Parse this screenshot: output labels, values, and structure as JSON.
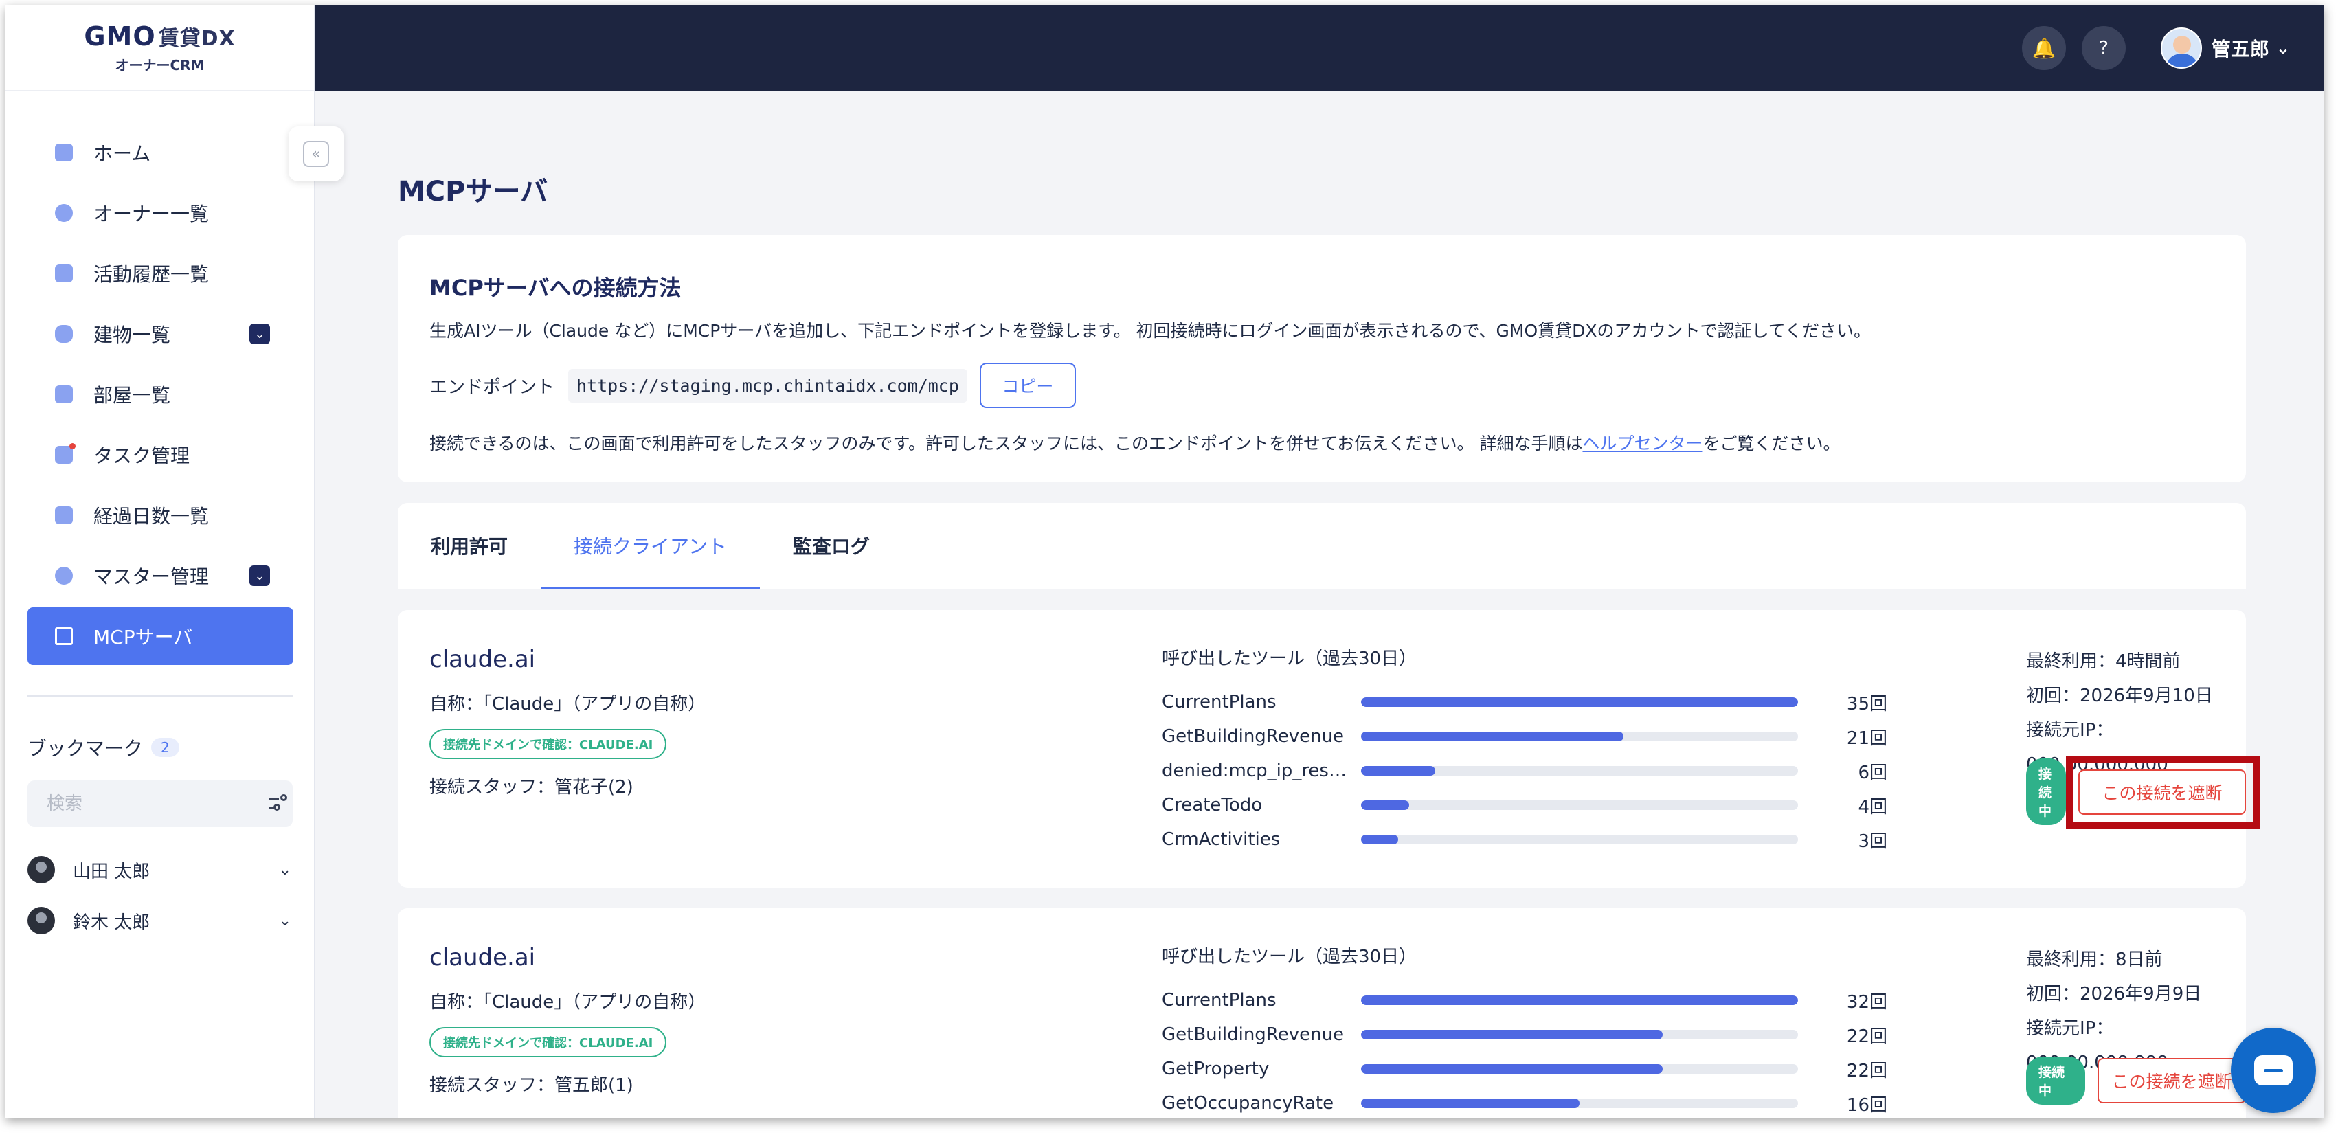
{
  "logo": {
    "brand": "GMO",
    "product": "賃貸DX",
    "sub": "オーナーCRM"
  },
  "sidebar": {
    "items": [
      {
        "label": "ホーム"
      },
      {
        "label": "オーナー一覧"
      },
      {
        "label": "活動履歴一覧"
      },
      {
        "label": "建物一覧",
        "expandable": true
      },
      {
        "label": "部屋一覧"
      },
      {
        "label": "タスク管理"
      },
      {
        "label": "経過日数一覧"
      },
      {
        "label": "マスター管理",
        "expandable": true
      },
      {
        "label": "MCPサーバ",
        "active": true
      }
    ],
    "bookmark": {
      "title": "ブックマーク",
      "count": "2",
      "search_placeholder": "検索",
      "users": [
        {
          "name": "山田 太郎"
        },
        {
          "name": "鈴木 太郎"
        }
      ]
    }
  },
  "header": {
    "user_name": "管五郎"
  },
  "page": {
    "title": "MCPサーバ"
  },
  "connect": {
    "title": "MCPサーバへの接続方法",
    "description": "生成AIツール（Claude など）にMCPサーバを追加し、下記エンドポイントを登録します。 初回接続時にログイン画面が表示されるので、GMO賃貸DXのアカウントで認証してください。",
    "endpoint_label": "エンドポイント",
    "endpoint_value": "https://staging.mcp.chintaidx.com/mcp",
    "copy_label": "コピー",
    "note_before": "接続できるのは、この画面で利用許可をしたスタッフのみです。許可したスタッフには、このエンドポイントを併せてお伝えください。 詳細な手順は",
    "note_link": "ヘルプセンター",
    "note_after": "をご覧ください。"
  },
  "tabs": [
    {
      "label": "利用許可"
    },
    {
      "label": "接続クライアント",
      "active": true
    },
    {
      "label": "監査ログ"
    }
  ],
  "clients": [
    {
      "name": "claude.ai",
      "self_name": "自称：「Claude」（アプリの自称）",
      "domain_badge": "接続先ドメインで確認：CLAUDE.AI",
      "staff": "接続スタッフ：管花子(2)",
      "tools_title": "呼び出したツール（過去30日）",
      "tools": [
        {
          "name": "CurrentPlans",
          "count_label": "35回",
          "ratio": 1.0
        },
        {
          "name": "GetBuildingRevenue",
          "count_label": "21回",
          "ratio": 0.6
        },
        {
          "name": "denied:mcp_ip_res…",
          "count_label": "6回",
          "ratio": 0.17
        },
        {
          "name": "CreateTodo",
          "count_label": "4回",
          "ratio": 0.11
        },
        {
          "name": "CrmActivities",
          "count_label": "3回",
          "ratio": 0.085
        }
      ],
      "last_used": "最終利用：4時間前",
      "first_used": "初回：2026年9月10日",
      "ip": "接続元IP：000.00.000.000",
      "status": "接続中",
      "block_label": "この接続を遮断",
      "highlighted": true
    },
    {
      "name": "claude.ai",
      "self_name": "自称：「Claude」（アプリの自称）",
      "domain_badge": "接続先ドメインで確認：CLAUDE.AI",
      "staff": "接続スタッフ：管五郎(1)",
      "tools_title": "呼び出したツール（過去30日）",
      "tools": [
        {
          "name": "CurrentPlans",
          "count_label": "32回",
          "ratio": 1.0
        },
        {
          "name": "GetBuildingRevenue",
          "count_label": "22回",
          "ratio": 0.69
        },
        {
          "name": "GetProperty",
          "count_label": "22回",
          "ratio": 0.69
        },
        {
          "name": "GetOccupancyRate",
          "count_label": "16回",
          "ratio": 0.5
        }
      ],
      "last_used": "最終利用：8日前",
      "first_used": "初回：2026年9月9日",
      "ip": "接続元IP：000.00.000.000",
      "status": "接続中",
      "block_label": "この接続を遮断",
      "highlighted": false
    }
  ],
  "colors": {
    "accent": "#4e74ef",
    "header": "#1d2540",
    "success": "#2fb18a",
    "danger": "#e5453d",
    "highlight": "#b50b13"
  },
  "icons": {
    "bell": "bell-icon",
    "help": "help-icon",
    "chat": "chat-icon",
    "collapse": "collapse-icon",
    "filter": "filter-icon"
  }
}
